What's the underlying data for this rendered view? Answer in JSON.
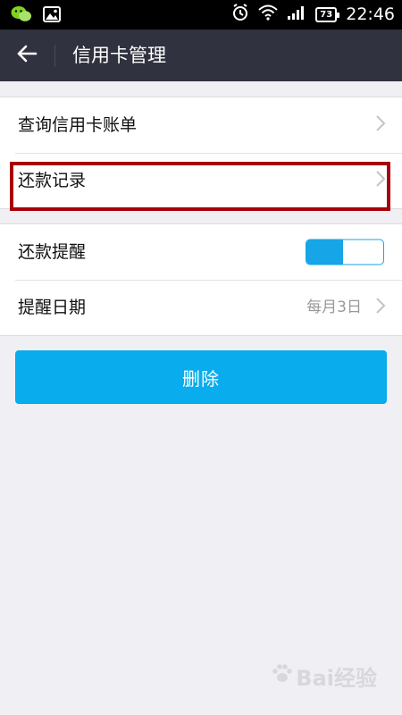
{
  "status_bar": {
    "time": "22:46",
    "battery": "73",
    "icons": [
      "wechat-icon",
      "image-icon",
      "alarm-icon",
      "wifi-icon",
      "signal-icon",
      "battery-icon"
    ]
  },
  "header": {
    "title": "信用卡管理",
    "back_icon": "arrow-left-icon"
  },
  "group_1": {
    "items": [
      {
        "label": "查询信用卡账单"
      },
      {
        "label": "还款记录",
        "highlighted": true
      }
    ]
  },
  "group_2": {
    "reminder": {
      "label": "还款提醒",
      "toggle_on": true
    },
    "date": {
      "label": "提醒日期",
      "value": "每月3日"
    }
  },
  "delete_button": {
    "label": "删除"
  },
  "watermark": {
    "text": "Bai经验"
  },
  "colors": {
    "status_bar": "#000000",
    "header_bg": "#30323f",
    "page_bg": "#efeff4",
    "accent": "#09aced",
    "highlight": "#a8000b"
  }
}
